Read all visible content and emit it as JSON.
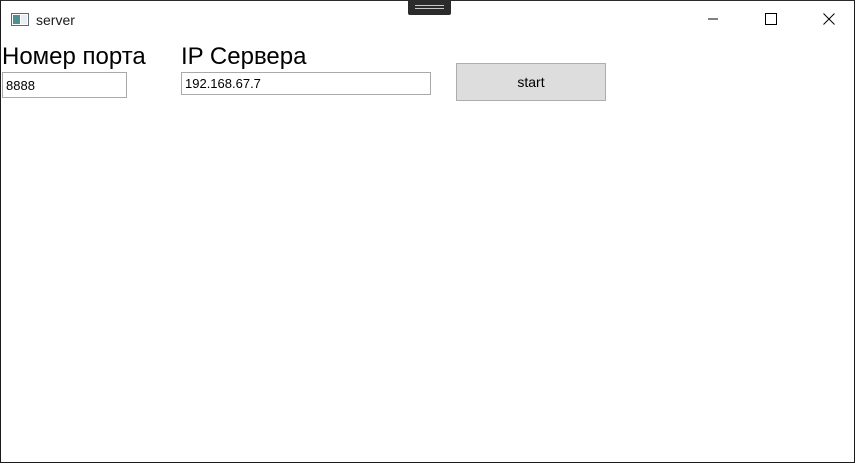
{
  "window": {
    "title": "server",
    "icon": "window-app-icon",
    "controls": {
      "minimize_icon": "minimize-icon",
      "maximize_icon": "maximize-icon",
      "close_icon": "close-icon"
    }
  },
  "form": {
    "port_label": "Номер порта",
    "port_value": "8888",
    "ip_label": "IP Сервера",
    "ip_value": "192.168.67.7",
    "start_label": "start"
  },
  "colors": {
    "button_face": "#dddddd",
    "button_border": "#adadad",
    "input_border": "#a9a9a9",
    "window_border": "#1b1b1b"
  }
}
